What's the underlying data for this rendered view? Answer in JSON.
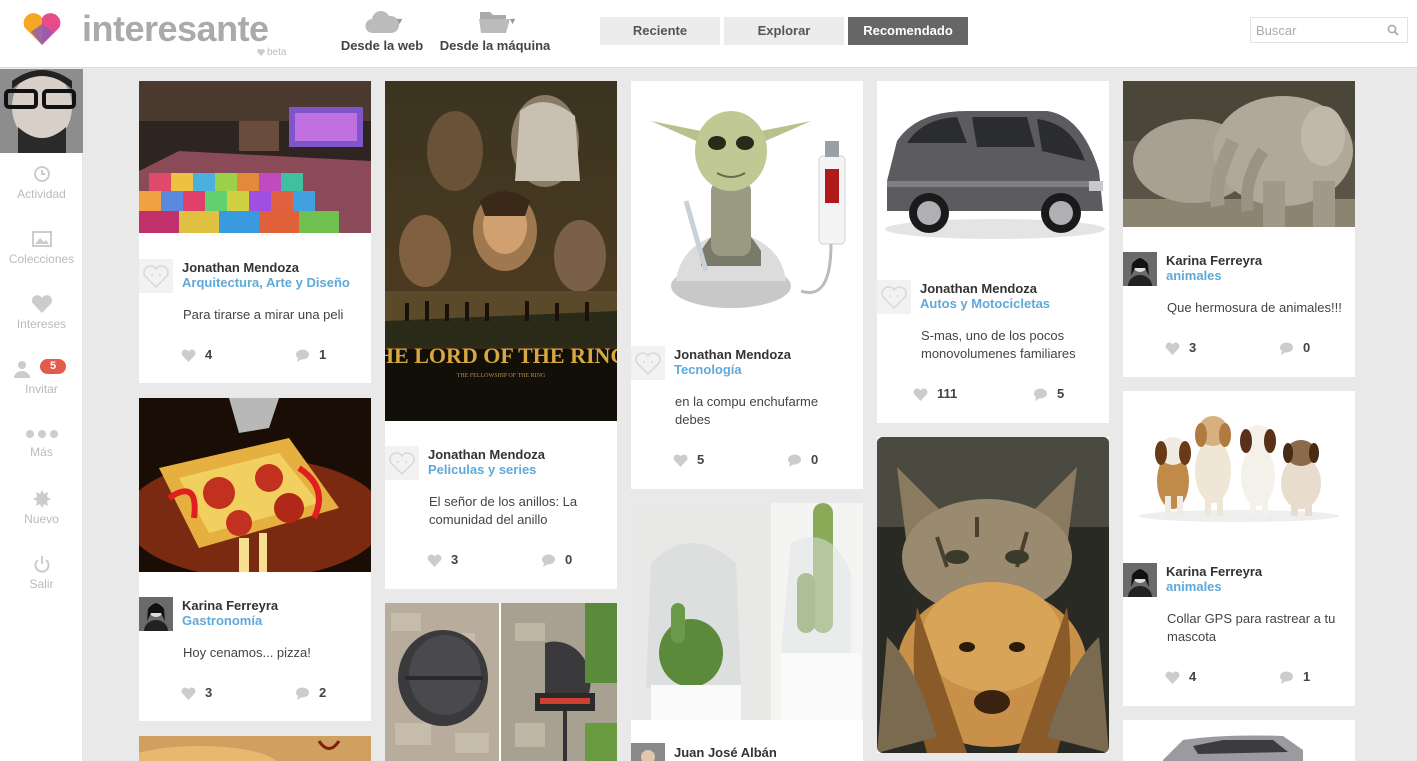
{
  "brand": {
    "name": "interesante",
    "tag": "beta"
  },
  "upload": {
    "web": "Desde la web",
    "machine": "Desde la máquina"
  },
  "tabs": [
    "Reciente",
    "Explorar",
    "Recomendado"
  ],
  "active_tab": "Recomendado",
  "search": {
    "placeholder": "Buscar",
    "value": ""
  },
  "sidebar": {
    "items": [
      {
        "label": "Actividad",
        "icon": "clock-icon"
      },
      {
        "label": "Colecciones",
        "icon": "image-icon"
      },
      {
        "label": "Intereses",
        "icon": "heart-icon"
      },
      {
        "label": "Invitar",
        "icon": "person-icon",
        "badge": "5"
      },
      {
        "label": "Más",
        "icon": "dots-icon"
      },
      {
        "label": "Nuevo",
        "icon": "badge-icon"
      },
      {
        "label": "Salir",
        "icon": "power-icon"
      }
    ]
  },
  "colors": {
    "accent": "#5fa9d9",
    "badge": "#e35b4a",
    "active_tab": "#666666",
    "background": "#e9e9e9"
  },
  "cards": [
    {
      "author": "Jonathan Mendoza",
      "category": "Arquitectura, Arte y Diseño",
      "desc": "Para tirarse a mirar una peli",
      "likes": "4",
      "comments": "1"
    },
    {
      "author": "Karina Ferreyra",
      "category": "Gastronomía",
      "desc": "Hoy cenamos... pizza!",
      "likes": "3",
      "comments": "2"
    },
    {
      "author": "Jonathan Mendoza",
      "category": "Peliculas y series",
      "desc": "El señor de los anillos: La comunidad del anillo",
      "likes": "3",
      "comments": "0",
      "poster_title": "THE LORD OF THE RINGS",
      "poster_sub": "THE FELLOWSHIP OF THE RING"
    },
    {
      "author": "Jonathan Mendoza",
      "category": "Tecnología",
      "desc": "en la compu enchufarme debes",
      "likes": "5",
      "comments": "0"
    },
    {
      "author": "Juan José Albán"
    },
    {
      "author": "Jonathan Mendoza",
      "category": "Autos y Motocicletas",
      "desc": "S-mas, uno de los pocos monovolumenes familiares",
      "likes": "111",
      "comments": "5"
    },
    {
      "author": "Karina Ferreyra",
      "category": "animales",
      "desc": "Que hermosura de animales!!!",
      "likes": "3",
      "comments": "0"
    },
    {
      "author": "Karina Ferreyra",
      "category": "animales",
      "desc": "Collar GPS para rastrear a tu mascota",
      "likes": "4",
      "comments": "1"
    }
  ]
}
